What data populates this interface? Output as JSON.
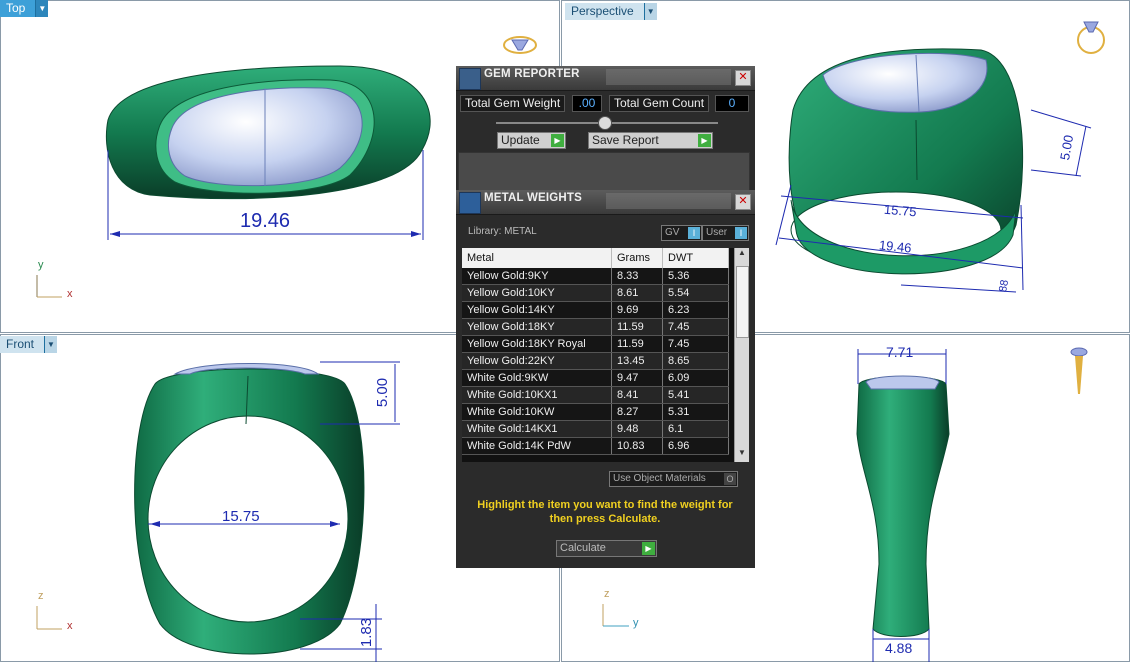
{
  "viewports": {
    "top": {
      "label": "Top",
      "dimension": "19.46",
      "axis_x": "x",
      "axis_y": "y"
    },
    "perspective": {
      "label": "Perspective",
      "dim_a": "15.75",
      "dim_b": "19.46",
      "dim_c": "5.00",
      "dim_d": "88"
    },
    "front": {
      "label": "Front",
      "dim_width": "15.75",
      "dim_height": "5.00",
      "dim_band": "1.83",
      "axis_x": "x",
      "axis_z": "z"
    },
    "right": {
      "dim_top": "7.71",
      "dim_bottom": "4.88",
      "axis_y": "y",
      "axis_z": "z"
    }
  },
  "gem_reporter": {
    "title": "GEM REPORTER",
    "total_weight_label": "Total Gem Weight",
    "total_weight_value": ".00",
    "total_count_label": "Total Gem Count",
    "total_count_value": "0",
    "update_label": "Update",
    "save_label": "Save Report"
  },
  "metal_weights": {
    "title": "METAL WEIGHTS",
    "library": "Library: METAL",
    "gv_label": "GV",
    "user_label": "User",
    "columns": [
      "Metal",
      "Grams",
      "DWT"
    ],
    "rows": [
      [
        "Yellow Gold:9KY",
        "8.33",
        "5.36"
      ],
      [
        "Yellow Gold:10KY",
        "8.61",
        "5.54"
      ],
      [
        "Yellow Gold:14KY",
        "9.69",
        "6.23"
      ],
      [
        "Yellow Gold:18KY",
        "11.59",
        "7.45"
      ],
      [
        "Yellow Gold:18KY Royal",
        "11.59",
        "7.45"
      ],
      [
        "Yellow Gold:22KY",
        "13.45",
        "8.65"
      ],
      [
        "White Gold:9KW",
        "9.47",
        "6.09"
      ],
      [
        "White Gold:10KX1",
        "8.41",
        "5.41"
      ],
      [
        "White Gold:10KW",
        "8.27",
        "5.31"
      ],
      [
        "White Gold:14KX1",
        "9.48",
        "6.1"
      ],
      [
        "White Gold:14K PdW",
        "10.83",
        "6.96"
      ]
    ],
    "use_object_label": "Use Object Materials",
    "hint": "Highlight the item you want to find the weight for then press Calculate.",
    "calculate_label": "Calculate"
  },
  "colors": {
    "tab_blue": "#3da0d8",
    "ring_green": "#1f8a5e",
    "dim_blue": "#1e2bb0",
    "hint_yellow": "#f0d020"
  }
}
